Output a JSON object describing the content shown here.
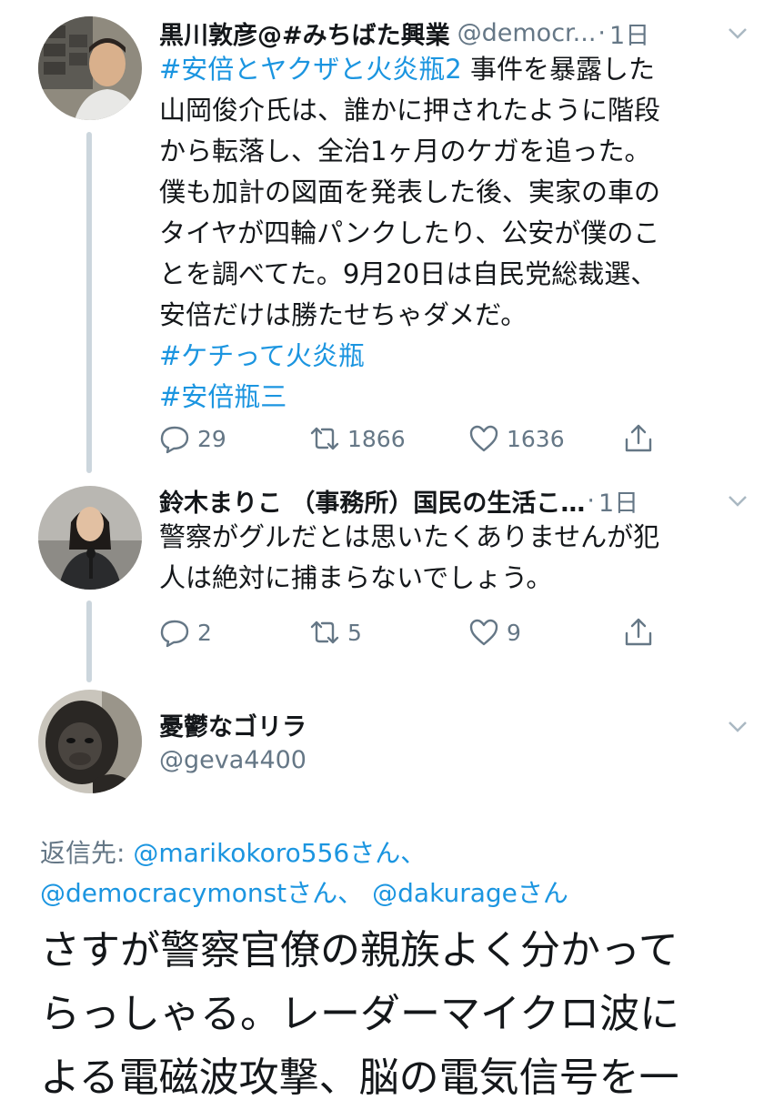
{
  "tweets": [
    {
      "display_name": "黒川敦彦@#みちばた興業",
      "handle": "@democr...",
      "dot": "·",
      "time": "1日",
      "lines": [
        {
          "tag": "#安倍とヤクザと火炎瓶2",
          "rest": " 事件を暴露した"
        },
        {
          "tag": "",
          "rest": "山岡俊介氏は、誰かに押されたように階段"
        },
        {
          "tag": "",
          "rest": "から転落し、全治1ヶ月のケガを追った。"
        },
        {
          "tag": "",
          "rest": "僕も加計の図面を発表した後、実家の車の"
        },
        {
          "tag": "",
          "rest": "タイヤが四輪パンクしたり、公安が僕のこ"
        },
        {
          "tag": "",
          "rest": "とを調べてた。9月20日は自民党総裁選、"
        },
        {
          "tag": "",
          "rest": "安倍だけは勝たせちゃダメだ。"
        },
        {
          "tag": "#ケチって火炎瓶",
          "rest": ""
        },
        {
          "tag": "#安倍瓶三",
          "rest": ""
        }
      ],
      "reply_count": "29",
      "retweet_count": "1866",
      "like_count": "1636"
    },
    {
      "display_name": "鈴木まりこ （事務所）国民の生活こ…",
      "dot": "·",
      "time": "1日",
      "lines": [
        {
          "tag": "",
          "rest": "警察がグルだとは思いたくありませんが犯"
        },
        {
          "tag": "",
          "rest": "人は絶対に捕まらないでしょう。"
        }
      ],
      "reply_count": "2",
      "retweet_count": "5",
      "like_count": "9"
    }
  ],
  "main_tweet": {
    "display_name": "憂鬱なゴリラ",
    "handle": "@geva4400",
    "reply_prefix": "返信先: ",
    "reply_user1": "@marikokoro556さん、",
    "reply_user2": "@democracymonstさん、",
    "reply_user3": "@dakurageさん",
    "lines": [
      "さすが警察官僚の親族よく分かって",
      "らっしゃる。レーダーマイクロ波に",
      "よる電磁波攻撃、脳の電気信号を一"
    ]
  },
  "icons": [
    "reply-icon",
    "retweet-icon",
    "like-icon",
    "share-icon",
    "chevron-down-icon"
  ],
  "colors": {
    "link": "#1b95e0",
    "secondary": "#657786",
    "thread_line": "#ccd6dd"
  }
}
